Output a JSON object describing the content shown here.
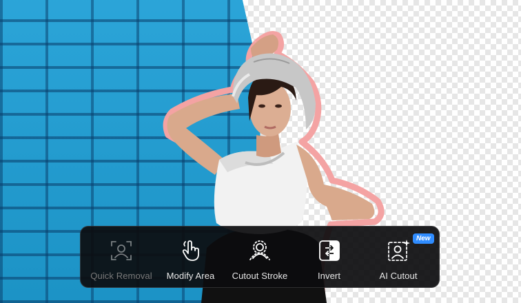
{
  "colors": {
    "wall": "#1e9fd6",
    "outline": "#f4a3a3",
    "toolbar_bg": "#0c0c0e",
    "badge": "#2f8cff"
  },
  "toolbar": {
    "tools": [
      {
        "label": "Quick Removal",
        "icon": "person-scan-icon",
        "enabled": false
      },
      {
        "label": "Modify Area",
        "icon": "hand-pointer-icon",
        "enabled": true
      },
      {
        "label": "Cutout Stroke",
        "icon": "person-stroke-icon",
        "enabled": true
      },
      {
        "label": "Invert",
        "icon": "invert-icon",
        "enabled": true
      },
      {
        "label": "AI Cutout",
        "icon": "ai-person-icon",
        "enabled": true,
        "badge": "New"
      }
    ]
  }
}
